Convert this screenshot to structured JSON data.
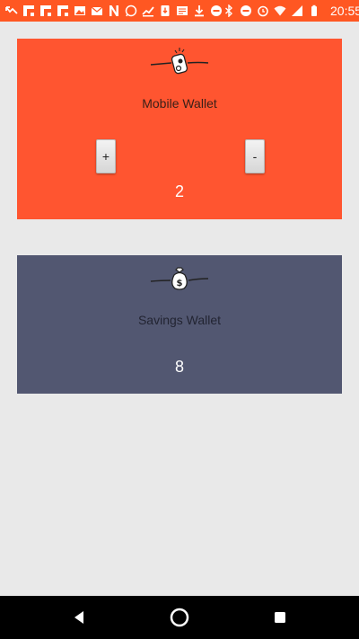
{
  "status_bar": {
    "time": "20:55",
    "left_icons": [
      "missed-call-icon",
      "flipboard-icon",
      "flipboard-icon",
      "flipboard-icon",
      "photos-icon",
      "mail-icon",
      "netflix-icon",
      "whatsapp-icon",
      "trend-icon",
      "sim-download-icon",
      "news-icon",
      "download-icon",
      "do-not-disturb-icon"
    ],
    "right_icons": [
      "bluetooth-icon",
      "do-not-disturb-icon",
      "alarm-icon",
      "wifi-icon",
      "signal-icon",
      "battery-icon"
    ]
  },
  "colors": {
    "status_bar": "#ff5722",
    "mobile_card": "#ff5530",
    "savings_card": "#525771",
    "background": "#e9e9e9"
  },
  "wallets": {
    "mobile": {
      "title": "Mobile Wallet",
      "amount": "2",
      "increment_label": "+",
      "decrement_label": "-",
      "icon": "flying-wallet-icon"
    },
    "savings": {
      "title": "Savings Wallet",
      "amount": "8",
      "icon": "flying-money-bag-icon"
    }
  },
  "nav_bar": {
    "items": [
      "back-icon",
      "home-icon",
      "recents-icon"
    ]
  }
}
